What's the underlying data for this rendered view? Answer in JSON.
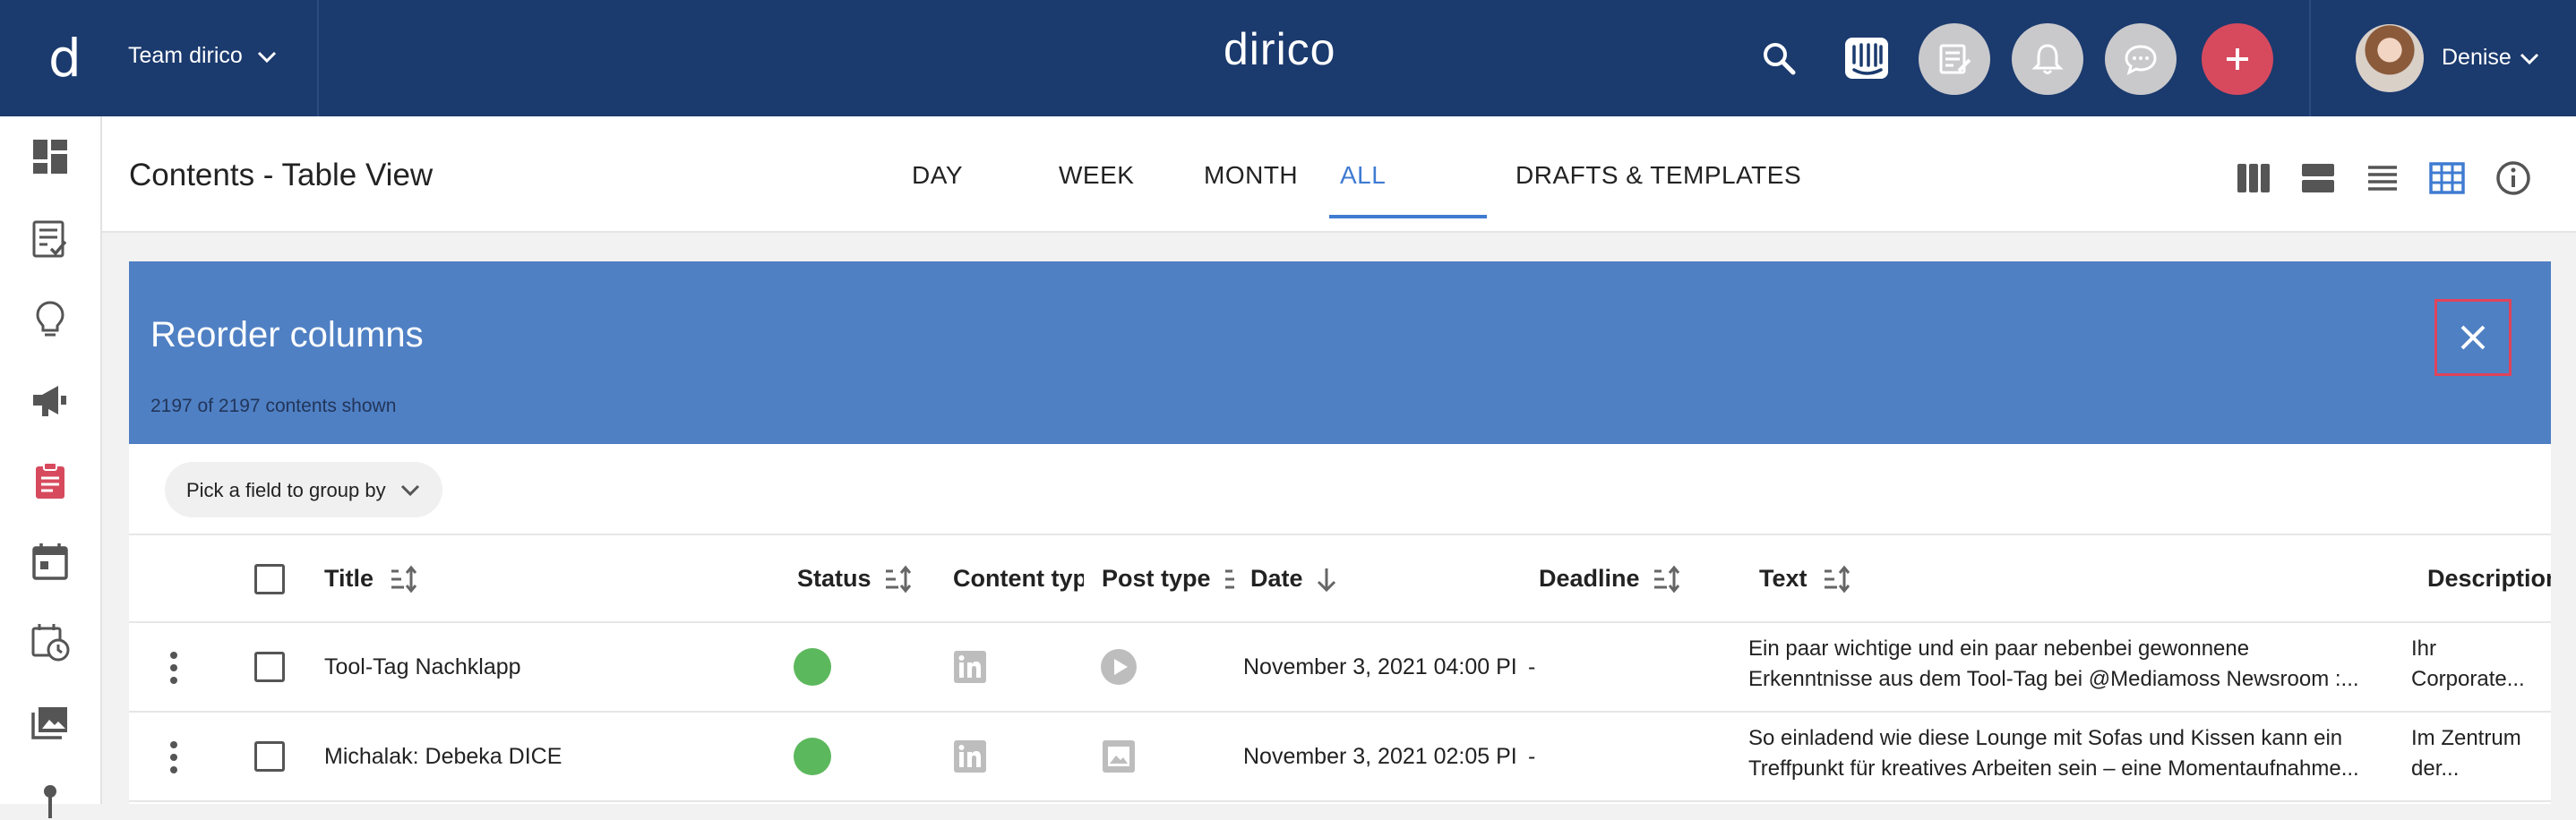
{
  "topbar": {
    "team_logo": "d",
    "team_name": "Team dirico",
    "brand": "dirico",
    "user_name": "Denise"
  },
  "subheader": {
    "title": "Contents - Table View",
    "tabs": [
      {
        "label": "DAY"
      },
      {
        "label": "WEEK"
      },
      {
        "label": "MONTH"
      },
      {
        "label": "ALL",
        "active": true
      },
      {
        "label": "DRAFTS & TEMPLATES"
      }
    ]
  },
  "banner": {
    "title": "Reorder columns",
    "count": "2197 of 2197 contents shown"
  },
  "group_by": {
    "label": "Pick a field to group by"
  },
  "table": {
    "columns": [
      "Title",
      "Status",
      "Content typ",
      "Post type",
      "Date",
      "Deadline",
      "Text",
      "Description"
    ],
    "rows": [
      {
        "title": "Tool-Tag Nachklapp",
        "date": "November 3, 2021 04:00 PI",
        "deadline": "-",
        "text_line1": "Ein paar wichtige und ein paar nebenbei gewonnene",
        "text_line2": "Erkenntnisse aus dem Tool-Tag bei @Mediamoss Newsroom :...",
        "desc_line1": "Ihr",
        "desc_line2": "Corporate..."
      },
      {
        "title": "Michalak: Debeka DICE",
        "date": "November 3, 2021 02:05 PI",
        "deadline": "-",
        "text_line1": "So einladend wie diese Lounge mit Sofas und Kissen kann ein",
        "text_line2": "Treffpunkt für kreatives Arbeiten sein – eine Momentaufnahme...",
        "desc_line1": "Im Zentrum",
        "desc_line2": "der..."
      }
    ]
  },
  "colors": {
    "topbar": "#1b3a6e",
    "banner": "#4f80c4",
    "accent": "#3f7bd1",
    "add_button": "#d74a5e",
    "status_ok": "#5cb85c",
    "highlight_border": "#e0435a"
  },
  "icons": [
    "search-icon",
    "intercom-icon",
    "drafts-icon",
    "bell-icon",
    "chat-icon",
    "plus-icon",
    "dashboard-icon",
    "checklist-icon",
    "lightbulb-icon",
    "megaphone-icon",
    "clipboard-icon",
    "calendar-icon",
    "calendar-clock-icon",
    "gallery-icon",
    "pin-icon",
    "board-view-icon",
    "split-view-icon",
    "list-view-icon",
    "table-view-icon",
    "info-icon",
    "close-icon",
    "linkedin-icon",
    "video-icon",
    "image-icon"
  ]
}
